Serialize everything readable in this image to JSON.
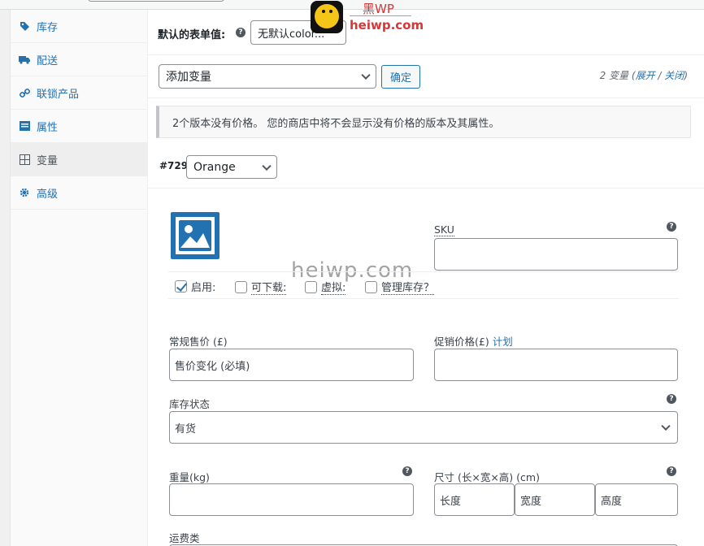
{
  "watermark": {
    "logo_text": "黑WP",
    "url": "heiwp.com",
    "center_text": "heiwp.com"
  },
  "tabs": [
    {
      "label": "库存",
      "icon": "tag-icon"
    },
    {
      "label": "配送",
      "icon": "truck-icon"
    },
    {
      "label": "联锁产品",
      "icon": "link-icon"
    },
    {
      "label": "属性",
      "icon": "list-icon"
    },
    {
      "label": "变量",
      "icon": "grid-icon",
      "active": true
    },
    {
      "label": "高级",
      "icon": "gear-icon"
    }
  ],
  "defaults": {
    "label": "默认的表单值:",
    "select_value": "无默认color..."
  },
  "toolbar": {
    "add_select": "添加变量",
    "go_label": "确定",
    "count_text": "2 变量",
    "expand": "展开",
    "separator": "/",
    "collapse": "关闭",
    "paren_open": "(",
    "paren_close": ")"
  },
  "notice": "2个版本没有价格。 您的商店中将不会显示没有价格的版本及其属性。",
  "variation": {
    "id": "#729",
    "attr_value": "Orange",
    "sku_label": "SKU",
    "checks": {
      "enabled": "启用:",
      "downloadable": "可下载:",
      "virtual": "虚拟:",
      "manage_stock": "管理库存？"
    },
    "regular_price_label": "常规售价 (£)",
    "regular_price_placeholder": "售价变化 (必填)",
    "sale_price_label": "促销价格(£)",
    "schedule_link": "计划",
    "stock_status_label": "库存状态",
    "stock_status_value": "有货",
    "weight_label": "重量(kg)",
    "dimensions_label": "尺寸 (长×宽×高) (cm)",
    "length_placeholder": "长度",
    "width_placeholder": "宽度",
    "height_placeholder": "高度",
    "shipping_class_label": "运费类"
  },
  "colors": {
    "link": "#2271b1",
    "text": "#1d2327",
    "watermark": "#d63638"
  }
}
